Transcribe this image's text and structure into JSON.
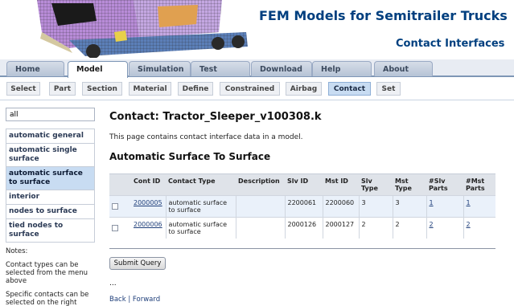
{
  "header": {
    "site_title": "FEM Models for Semitrailer Trucks",
    "page_subtitle": "Contact Interfaces"
  },
  "tabs": [
    {
      "label": "Home",
      "active": false
    },
    {
      "label": "Model",
      "active": true
    },
    {
      "label": "Simulation",
      "active": false
    },
    {
      "label": "Test",
      "active": false
    },
    {
      "label": "Download",
      "active": false
    },
    {
      "label": "Help",
      "active": false
    },
    {
      "label": "About",
      "active": false
    }
  ],
  "subnav": [
    {
      "label": "Select",
      "active": false
    },
    {
      "label": "Part",
      "active": false
    },
    {
      "label": "Section",
      "active": false
    },
    {
      "label": "Material",
      "active": false
    },
    {
      "label": "Define",
      "active": false
    },
    {
      "label": "Constrained",
      "active": false
    },
    {
      "label": "Airbag",
      "active": false
    },
    {
      "label": "Contact",
      "active": true
    },
    {
      "label": "Set",
      "active": false
    }
  ],
  "sidebar": {
    "filter_value": "all",
    "items": [
      {
        "label": "automatic general",
        "active": false
      },
      {
        "label": "automatic single surface",
        "active": false
      },
      {
        "label": "automatic surface to surface",
        "active": true
      },
      {
        "label": "interior",
        "active": false
      },
      {
        "label": "nodes to surface",
        "active": false
      },
      {
        "label": "tied nodes to surface",
        "active": false
      }
    ],
    "notes_title": "Notes:",
    "note_1": "Contact types can be selected from the menu above",
    "note_2": "Specific contacts can be selected on the right"
  },
  "content": {
    "title": "Contact: Tractor_Sleeper_v100308.k",
    "description": "This page contains contact interface data in a model.",
    "section_title": "Automatic Surface To Surface",
    "columns": [
      "Cont ID",
      "Contact Type",
      "Description",
      "Slv ID",
      "Mst ID",
      "Slv Type",
      "Mst Type",
      "#Slv Parts",
      "#Mst Parts"
    ],
    "rows": [
      {
        "cont_id": "2000005",
        "contact_type": "automatic surface to surface",
        "description": "",
        "slv_id": "2200061",
        "mst_id": "2200060",
        "slv_type": "3",
        "mst_type": "3",
        "slv_parts": "1",
        "mst_parts": "1"
      },
      {
        "cont_id": "2000006",
        "contact_type": "automatic surface to surface",
        "description": "",
        "slv_id": "2000126",
        "mst_id": "2000127",
        "slv_type": "2",
        "mst_type": "2",
        "slv_parts": "2",
        "mst_parts": "2"
      }
    ],
    "submit_label": "Submit Query",
    "ellipsis": "...",
    "back_label": "Back",
    "separator": "|",
    "forward_label": "Forward"
  },
  "colors": {
    "title_blue": "#003f7f",
    "active_blue": "#c8dcf2",
    "row_highlight": "#eaf1fa"
  }
}
